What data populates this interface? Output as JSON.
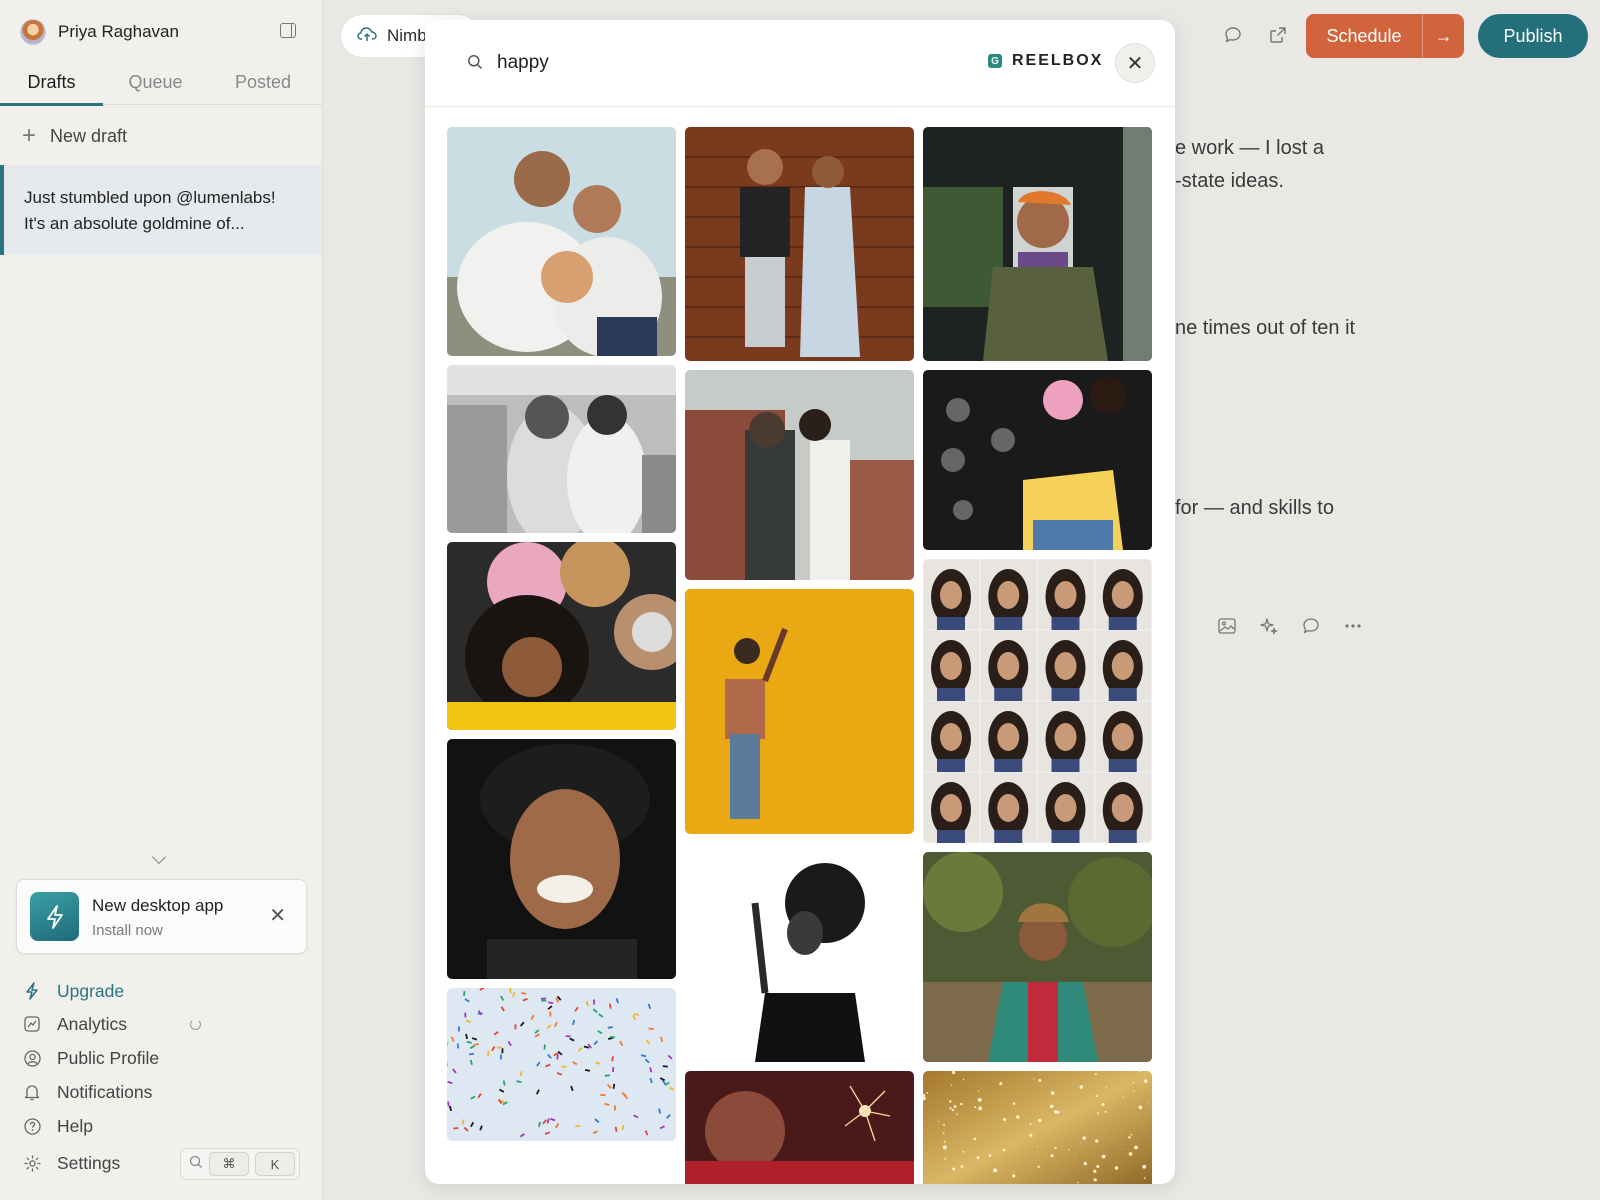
{
  "user": {
    "name": "Priya Raghavan"
  },
  "tabs": [
    {
      "label": "Drafts",
      "active": true
    },
    {
      "label": "Queue",
      "active": false
    },
    {
      "label": "Posted",
      "active": false
    }
  ],
  "new_draft_label": "New draft",
  "drafts": [
    {
      "line1": "Just stumbled upon @lumenlabs!",
      "line2": "It's an absolute goldmine of..."
    }
  ],
  "install_card": {
    "title": "New desktop app",
    "subtitle": "Install now"
  },
  "nav": [
    {
      "label": "Upgrade",
      "icon": "bolt-icon"
    },
    {
      "label": "Analytics",
      "icon": "chart-icon"
    },
    {
      "label": "Public Profile",
      "icon": "user-circle-icon"
    },
    {
      "label": "Notifications",
      "icon": "bell-icon"
    },
    {
      "label": "Help",
      "icon": "help-icon"
    },
    {
      "label": "Settings",
      "icon": "gear-icon"
    }
  ],
  "shortcut": {
    "mod": "⌘",
    "key": "K"
  },
  "header": {
    "doc_chip": "Nimb",
    "schedule_label": "Schedule",
    "publish_label": "Publish"
  },
  "editor_lines": [
    "e work — I lost a",
    "-state ideas.",
    "ne times out of ten it",
    " for — and skills to"
  ],
  "modal": {
    "search_value": "happy",
    "brand": "REELBOX",
    "brand_mark": "G"
  },
  "colors": {
    "accent": "#2a7480",
    "schedule": "#d2643d",
    "publish": "#236f7b"
  }
}
